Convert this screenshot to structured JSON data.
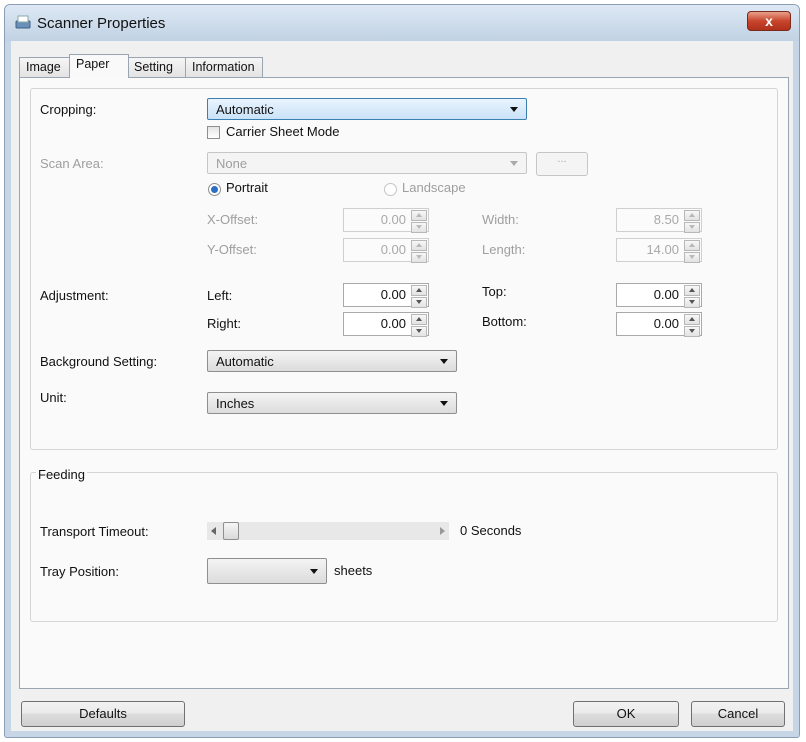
{
  "window": {
    "title": "Scanner Properties",
    "close_glyph": "x"
  },
  "tabs": [
    {
      "label": "Image"
    },
    {
      "label": "Paper"
    },
    {
      "label": "Setting"
    },
    {
      "label": "Information"
    }
  ],
  "paper": {
    "cropping": {
      "label": "Cropping:",
      "value": "Automatic",
      "carrier_sheet_label": "Carrier Sheet Mode"
    },
    "scan_area": {
      "label": "Scan Area:",
      "value": "None",
      "browse_label": "...",
      "portrait_label": "Portrait",
      "landscape_label": "Landscape",
      "x_offset_label": "X-Offset:",
      "x_offset": "0.00",
      "y_offset_label": "Y-Offset:",
      "y_offset": "0.00",
      "width_label": "Width:",
      "width": "8.50",
      "length_label": "Length:",
      "length": "14.00"
    },
    "adjustment": {
      "label": "Adjustment:",
      "left_label": "Left:",
      "left": "0.00",
      "right_label": "Right:",
      "right": "0.00",
      "top_label": "Top:",
      "top": "0.00",
      "bottom_label": "Bottom:",
      "bottom": "0.00"
    },
    "background": {
      "label": "Background Setting:",
      "value": "Automatic"
    },
    "unit": {
      "label": "Unit:",
      "value": "Inches"
    }
  },
  "feeding": {
    "title": "Feeding",
    "transport_timeout_label": "Transport Timeout:",
    "transport_timeout_value": "0 Seconds",
    "tray_position_label": "Tray Position:",
    "tray_position_value": "",
    "tray_unit": "sheets"
  },
  "footer": {
    "defaults_label": "Defaults",
    "ok_label": "OK",
    "cancel_label": "Cancel"
  },
  "colors": {
    "title_bar": "#c7d6e6",
    "close_button": "#c8452c",
    "selected_combo": "#c9e2f8",
    "radio_selected": "#2b6fc4"
  }
}
